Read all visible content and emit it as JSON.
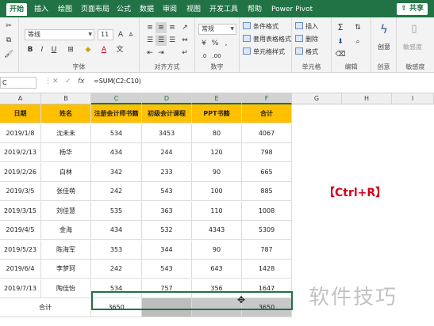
{
  "ribbon_tabs": [
    "开始",
    "插入",
    "绘图",
    "页面布局",
    "公式",
    "数据",
    "审阅",
    "视图",
    "开发工具",
    "帮助",
    "Power Pivot"
  ],
  "active_tab": "开始",
  "share_label": "共享",
  "font_group": {
    "font_name": "等线",
    "font_size": "11",
    "label": "字体"
  },
  "alignment_group": {
    "label": "对齐方式"
  },
  "number_group": {
    "format": "常规",
    "label": "数字"
  },
  "styles_group": {
    "items": [
      "条件格式",
      "套用表格格式",
      "单元格样式"
    ]
  },
  "cells_group": {
    "items": [
      "插入",
      "删除",
      "格式"
    ],
    "label": "单元格"
  },
  "editing_group": {
    "label": "编辑"
  },
  "ideas_group": {
    "button": "创意",
    "label": "创意"
  },
  "sensitivity_group": {
    "button": "敏感度",
    "label": "敏感度"
  },
  "name_box": "C",
  "formula_bar": {
    "fx": "fx",
    "formula": "=SUM(C2:C10)"
  },
  "columns": [
    "A",
    "B",
    "C",
    "D",
    "E",
    "F",
    "G",
    "H",
    "I"
  ],
  "table": {
    "headers": [
      "日期",
      "姓名",
      "注册会计师书籍",
      "初级会计课程",
      "PPT书籍",
      "合计"
    ],
    "rows": [
      [
        "2019/1/8",
        "沈未未",
        "534",
        "3453",
        "80",
        "4067"
      ],
      [
        "2019/2/13",
        "杨华",
        "434",
        "244",
        "120",
        "798"
      ],
      [
        "2019/2/26",
        "白林",
        "342",
        "233",
        "90",
        "665"
      ],
      [
        "2019/3/5",
        "张佳萌",
        "242",
        "543",
        "100",
        "885"
      ],
      [
        "2019/3/15",
        "刘佳慧",
        "535",
        "363",
        "110",
        "1008"
      ],
      [
        "2019/4/5",
        "金海",
        "434",
        "532",
        "4343",
        "5309"
      ],
      [
        "2019/5/23",
        "陈海军",
        "353",
        "344",
        "90",
        "787"
      ],
      [
        "2019/6/4",
        "李梦珂",
        "242",
        "543",
        "643",
        "1428"
      ],
      [
        "2019/7/13",
        "陶佳怡",
        "534",
        "757",
        "356",
        "1647"
      ]
    ],
    "total_label": "合计",
    "total_c": "3650",
    "total_f": "3650"
  },
  "shortcut_label": "【Ctrl+R】",
  "watermark": "软件技巧"
}
